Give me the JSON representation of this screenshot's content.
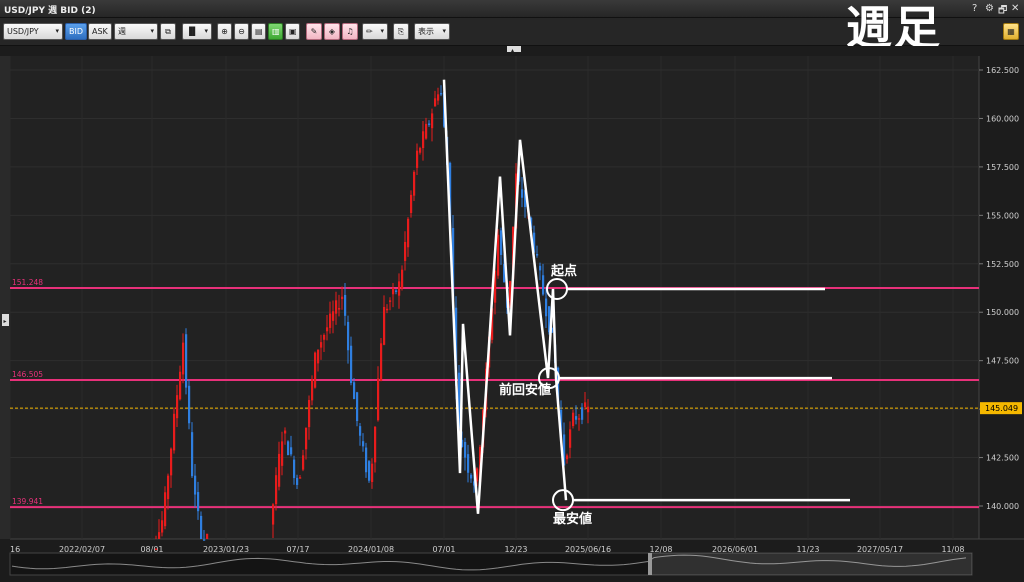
{
  "window": {
    "title": "USD/JPY 週 BID (2)",
    "controls": [
      "?",
      "⚙",
      "🗗",
      "✕"
    ]
  },
  "toolbar": {
    "symbol": "USD/JPY",
    "bid_label": "BID",
    "ask_label": "ASK",
    "period": "週",
    "display_label": "表示"
  },
  "overlay_label": "週足",
  "annotations": {
    "start": "起点",
    "prev_low": "前回安値",
    "lowest": "最安値"
  },
  "chart_data": {
    "type": "candlestick",
    "title": "",
    "y_ticks": [
      140.0,
      142.5,
      145.0,
      147.5,
      150.0,
      152.5,
      155.0,
      157.5,
      160.0,
      162.5
    ],
    "y_tick_labels": [
      "140.000",
      "142.500",
      "145.000",
      "147.500",
      "150.000",
      "152.500",
      "155.000",
      "157.500",
      "160.000",
      "162.500"
    ],
    "ylim": [
      138.3,
      163.0
    ],
    "x_tick_labels": [
      "16",
      "2022/02/07",
      "08/01",
      "2023/01/23",
      "07/17",
      "2024/01/08",
      "07/01",
      "12/23",
      "2025/06/16",
      "12/08",
      "2026/06/01",
      "11/23",
      "2027/05/17",
      "11/08"
    ],
    "current_price": {
      "value": 145.049,
      "label": "145.049",
      "color": "#f5b800"
    },
    "horizontal_lines": [
      {
        "value": 151.248,
        "label": "151.248",
        "color": "#e8317a"
      },
      {
        "value": 146.505,
        "label": "146.505",
        "color": "#e8317a"
      },
      {
        "value": 139.941,
        "label": "139.941",
        "color": "#e8317a"
      }
    ],
    "up_color": "#e81c1c",
    "down_color": "#2f7fe0",
    "zigzag_price_points": [
      162.0,
      141.7,
      149.4,
      139.6,
      157.0,
      148.8,
      158.9,
      146.6,
      151.2,
      146.6,
      140.3
    ],
    "annotation_circles": [
      {
        "label": "起点",
        "price": 151.2
      },
      {
        "label": "前回安値",
        "price": 146.6
      },
      {
        "label": "最安値",
        "price": 140.3
      }
    ]
  }
}
